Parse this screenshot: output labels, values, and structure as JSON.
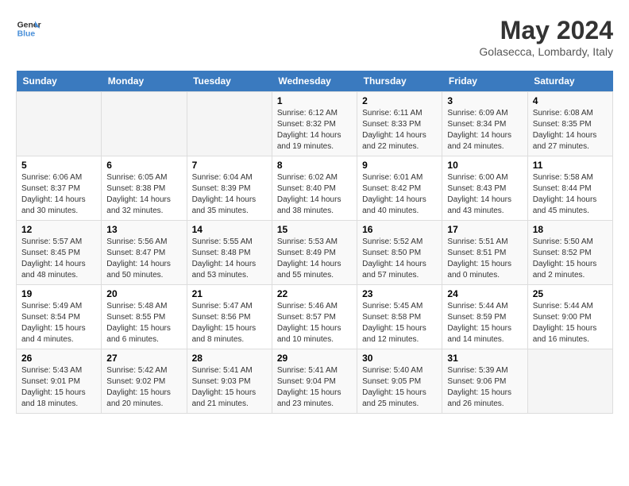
{
  "header": {
    "logo_line1": "General",
    "logo_line2": "Blue",
    "month": "May 2024",
    "location": "Golasecca, Lombardy, Italy"
  },
  "days_of_week": [
    "Sunday",
    "Monday",
    "Tuesday",
    "Wednesday",
    "Thursday",
    "Friday",
    "Saturday"
  ],
  "weeks": [
    [
      {
        "day": "",
        "info": ""
      },
      {
        "day": "",
        "info": ""
      },
      {
        "day": "",
        "info": ""
      },
      {
        "day": "1",
        "info": "Sunrise: 6:12 AM\nSunset: 8:32 PM\nDaylight: 14 hours\nand 19 minutes."
      },
      {
        "day": "2",
        "info": "Sunrise: 6:11 AM\nSunset: 8:33 PM\nDaylight: 14 hours\nand 22 minutes."
      },
      {
        "day": "3",
        "info": "Sunrise: 6:09 AM\nSunset: 8:34 PM\nDaylight: 14 hours\nand 24 minutes."
      },
      {
        "day": "4",
        "info": "Sunrise: 6:08 AM\nSunset: 8:35 PM\nDaylight: 14 hours\nand 27 minutes."
      }
    ],
    [
      {
        "day": "5",
        "info": "Sunrise: 6:06 AM\nSunset: 8:37 PM\nDaylight: 14 hours\nand 30 minutes."
      },
      {
        "day": "6",
        "info": "Sunrise: 6:05 AM\nSunset: 8:38 PM\nDaylight: 14 hours\nand 32 minutes."
      },
      {
        "day": "7",
        "info": "Sunrise: 6:04 AM\nSunset: 8:39 PM\nDaylight: 14 hours\nand 35 minutes."
      },
      {
        "day": "8",
        "info": "Sunrise: 6:02 AM\nSunset: 8:40 PM\nDaylight: 14 hours\nand 38 minutes."
      },
      {
        "day": "9",
        "info": "Sunrise: 6:01 AM\nSunset: 8:42 PM\nDaylight: 14 hours\nand 40 minutes."
      },
      {
        "day": "10",
        "info": "Sunrise: 6:00 AM\nSunset: 8:43 PM\nDaylight: 14 hours\nand 43 minutes."
      },
      {
        "day": "11",
        "info": "Sunrise: 5:58 AM\nSunset: 8:44 PM\nDaylight: 14 hours\nand 45 minutes."
      }
    ],
    [
      {
        "day": "12",
        "info": "Sunrise: 5:57 AM\nSunset: 8:45 PM\nDaylight: 14 hours\nand 48 minutes."
      },
      {
        "day": "13",
        "info": "Sunrise: 5:56 AM\nSunset: 8:47 PM\nDaylight: 14 hours\nand 50 minutes."
      },
      {
        "day": "14",
        "info": "Sunrise: 5:55 AM\nSunset: 8:48 PM\nDaylight: 14 hours\nand 53 minutes."
      },
      {
        "day": "15",
        "info": "Sunrise: 5:53 AM\nSunset: 8:49 PM\nDaylight: 14 hours\nand 55 minutes."
      },
      {
        "day": "16",
        "info": "Sunrise: 5:52 AM\nSunset: 8:50 PM\nDaylight: 14 hours\nand 57 minutes."
      },
      {
        "day": "17",
        "info": "Sunrise: 5:51 AM\nSunset: 8:51 PM\nDaylight: 15 hours\nand 0 minutes."
      },
      {
        "day": "18",
        "info": "Sunrise: 5:50 AM\nSunset: 8:52 PM\nDaylight: 15 hours\nand 2 minutes."
      }
    ],
    [
      {
        "day": "19",
        "info": "Sunrise: 5:49 AM\nSunset: 8:54 PM\nDaylight: 15 hours\nand 4 minutes."
      },
      {
        "day": "20",
        "info": "Sunrise: 5:48 AM\nSunset: 8:55 PM\nDaylight: 15 hours\nand 6 minutes."
      },
      {
        "day": "21",
        "info": "Sunrise: 5:47 AM\nSunset: 8:56 PM\nDaylight: 15 hours\nand 8 minutes."
      },
      {
        "day": "22",
        "info": "Sunrise: 5:46 AM\nSunset: 8:57 PM\nDaylight: 15 hours\nand 10 minutes."
      },
      {
        "day": "23",
        "info": "Sunrise: 5:45 AM\nSunset: 8:58 PM\nDaylight: 15 hours\nand 12 minutes."
      },
      {
        "day": "24",
        "info": "Sunrise: 5:44 AM\nSunset: 8:59 PM\nDaylight: 15 hours\nand 14 minutes."
      },
      {
        "day": "25",
        "info": "Sunrise: 5:44 AM\nSunset: 9:00 PM\nDaylight: 15 hours\nand 16 minutes."
      }
    ],
    [
      {
        "day": "26",
        "info": "Sunrise: 5:43 AM\nSunset: 9:01 PM\nDaylight: 15 hours\nand 18 minutes."
      },
      {
        "day": "27",
        "info": "Sunrise: 5:42 AM\nSunset: 9:02 PM\nDaylight: 15 hours\nand 20 minutes."
      },
      {
        "day": "28",
        "info": "Sunrise: 5:41 AM\nSunset: 9:03 PM\nDaylight: 15 hours\nand 21 minutes."
      },
      {
        "day": "29",
        "info": "Sunrise: 5:41 AM\nSunset: 9:04 PM\nDaylight: 15 hours\nand 23 minutes."
      },
      {
        "day": "30",
        "info": "Sunrise: 5:40 AM\nSunset: 9:05 PM\nDaylight: 15 hours\nand 25 minutes."
      },
      {
        "day": "31",
        "info": "Sunrise: 5:39 AM\nSunset: 9:06 PM\nDaylight: 15 hours\nand 26 minutes."
      },
      {
        "day": "",
        "info": ""
      }
    ]
  ]
}
